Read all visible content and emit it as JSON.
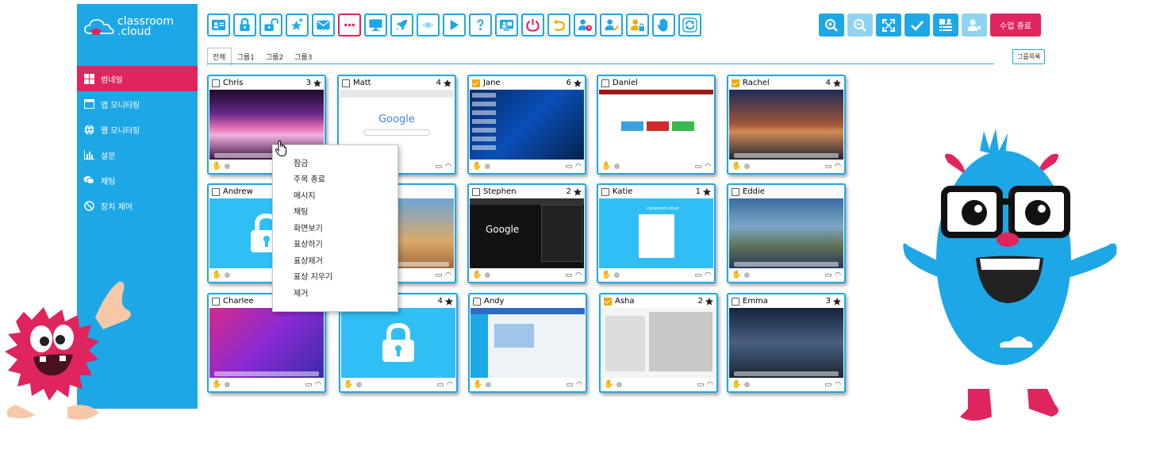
{
  "app": {
    "logo_line1": "classroom",
    "logo_line2": ".cloud"
  },
  "sidebar": {
    "items": [
      {
        "label": "썸네일",
        "icon": "grid-icon",
        "active": true
      },
      {
        "label": "앱 모니터링",
        "icon": "window-icon",
        "active": false
      },
      {
        "label": "웹 모니터링",
        "icon": "globe-icon",
        "active": false
      },
      {
        "label": "설문",
        "icon": "bar-chart-icon",
        "active": false
      },
      {
        "label": "채팅",
        "icon": "chat-icon",
        "active": false
      },
      {
        "label": "장치 제어",
        "icon": "block-icon",
        "active": false
      }
    ]
  },
  "toolbar": {
    "buttons": [
      "contact-card-icon",
      "lock-icon",
      "unlock-icon",
      "star-add-icon",
      "mail-icon",
      "more-dots-icon",
      "monitor-icon",
      "rocket-icon",
      "eye-icon",
      "play-icon",
      "question-icon",
      "screen-share-icon",
      "power-icon",
      "undo-icon",
      "user-clock-icon",
      "user-check-icon",
      "user-lock-icon",
      "hand-icon",
      "refresh-icon"
    ],
    "right_buttons": [
      "zoom-in-icon",
      "zoom-out-icon",
      "fullscreen-icon",
      "check-icon",
      "layout-icon",
      "user-remove-icon"
    ],
    "end_class_label": "수업 종료"
  },
  "tabs": [
    "전체",
    "그룹1",
    "그룹2",
    "그룹3"
  ],
  "group_list_label": "그룹목록",
  "students": [
    {
      "name": "Chris",
      "score": "3",
      "checked": false
    },
    {
      "name": "Matt",
      "score": "4",
      "checked": false
    },
    {
      "name": "Jane",
      "score": "6",
      "checked": true
    },
    {
      "name": "Daniel",
      "score": "",
      "checked": false
    },
    {
      "name": "Rachel",
      "score": "4",
      "checked": true
    },
    {
      "name": "Andrew",
      "score": "",
      "checked": false
    },
    {
      "name": "Stephen",
      "score": "2",
      "checked": false
    },
    {
      "name": "Katie",
      "score": "1",
      "checked": false
    },
    {
      "name": "Eddie",
      "score": "",
      "checked": false
    },
    {
      "name": "Charlee",
      "score": "",
      "checked": false
    },
    {
      "name": "",
      "score": "4",
      "checked": false
    },
    {
      "name": "Andy",
      "score": "",
      "checked": false
    },
    {
      "name": "Asha",
      "score": "2",
      "checked": true
    },
    {
      "name": "Emma",
      "score": "3",
      "checked": false
    }
  ],
  "context_menu": [
    "잠금",
    "주목 종료",
    "메시지",
    "채팅",
    "화면보기",
    "표상하기",
    "표상제거",
    "표상 지우기",
    "제거"
  ],
  "screens": {
    "matt_google_text": "Google",
    "stephen_google_text": "Google",
    "katie_brand": "classroom.cloud"
  },
  "colors": {
    "accent": "#1ea7e6",
    "brand_red": "#e0245e",
    "check_orange": "#f2a900"
  }
}
